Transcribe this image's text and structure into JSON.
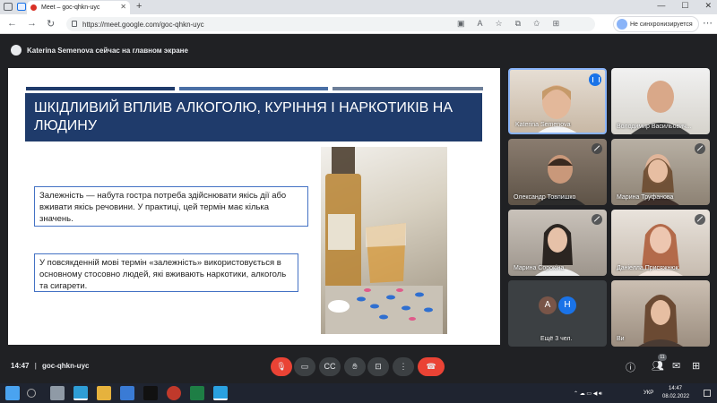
{
  "browser": {
    "tab_title": "Meet – goc-qhkn-uyc",
    "url": "https://meet.google.com/goc-qhkn-uyc",
    "sync_label": "Не синхронизируется"
  },
  "meet": {
    "presenting_text": "Katerina Semenova сейчас на главном экране",
    "meeting_code": "goc-qhkn-uyc",
    "time": "14:47",
    "participants_count": "11",
    "more_label": "Ещё 3 чел."
  },
  "slide": {
    "title": "ШКІДЛИВИЙ ВПЛИВ АЛКОГОЛЮ, КУРІННЯ І НАРКОТИКІВ НА ЛЮДИНУ",
    "definition": "Залежність — набута гостра потреба здійснювати якісь дії або вживати якісь речовини. У практиці, цей термін має кілька значень.",
    "usage": "У повсякденній мові термін «залежність» використовується в основному стосовно людей, які вживають наркотики, алкоголь та сигарети."
  },
  "participants": [
    {
      "name": "Katerina Semenova"
    },
    {
      "name": "Володимир Васильович..."
    },
    {
      "name": "Олександр Товпишко"
    },
    {
      "name": "Марина Труфанова"
    },
    {
      "name": "Марина Сорокіна"
    },
    {
      "name": "Даніелла Присяжнюк"
    },
    {
      "name": "Ви"
    }
  ],
  "more_initials": [
    "А",
    "Н"
  ],
  "taskbar": {
    "lang": "УКР",
    "time": "14:47",
    "date": "08.02.2022"
  },
  "colors": {
    "meet_bg": "#202124",
    "slide_title_bg": "#1f3b6b",
    "end_call": "#ea4335",
    "accent_blue": "#1a73e8"
  }
}
